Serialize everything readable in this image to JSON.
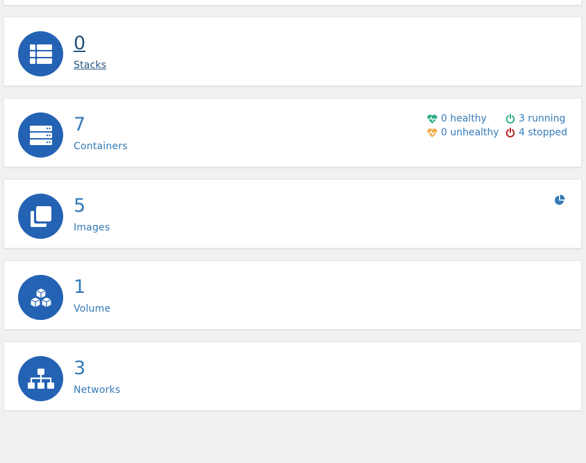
{
  "dashboard": {
    "stacks": {
      "count": "0",
      "label": "Stacks"
    },
    "containers": {
      "count": "7",
      "label": "Containers",
      "healthy": "0 healthy",
      "unhealthy": "0 unhealthy",
      "running": "3 running",
      "stopped": "4 stopped"
    },
    "images": {
      "count": "5",
      "label": "Images"
    },
    "volumes": {
      "count": "1",
      "label": "Volume"
    },
    "networks": {
      "count": "3",
      "label": "Networks"
    }
  },
  "colors": {
    "accent": "#2462b4",
    "link": "#337ab7",
    "healthy": "#2eaf8c",
    "unhealthy": "#f0ad4e",
    "running": "#2eaf8c",
    "stopped": "#b52220",
    "background": "#f1f1f1"
  },
  "icons": {
    "stacks": "th-list-icon",
    "containers": "server-icon",
    "images": "clone-icon",
    "volumes": "cubes-icon",
    "networks": "sitemap-icon",
    "healthy": "heartbeat-icon",
    "unhealthy": "heartbeat-icon",
    "running": "power-icon",
    "stopped": "power-icon",
    "image-usage": "pie-chart-icon"
  }
}
